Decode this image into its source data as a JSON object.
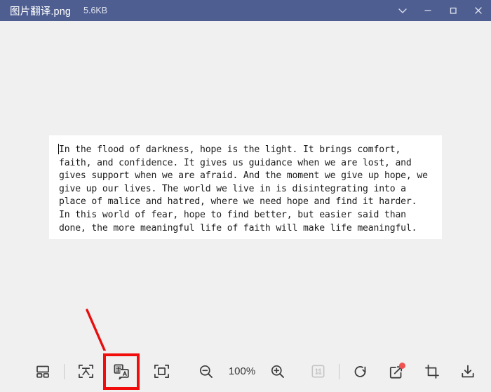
{
  "window": {
    "file_name": "图片翻译.png",
    "file_size": "5.6KB",
    "controls": [
      {
        "name": "chevron-down",
        "label": "∨"
      },
      {
        "name": "minimize",
        "label": "—"
      },
      {
        "name": "maximize",
        "label": "□"
      },
      {
        "name": "close",
        "label": "✕"
      }
    ]
  },
  "document": {
    "body_text": "In the flood of darkness, hope is the light. It brings comfort,\nfaith, and confidence. It gives us guidance when we are lost, and\ngives support when we are afraid. And the moment we give up hope, we\ngive up our lives. The world we live in is disintegrating into a\nplace of malice and hatred, where we need hope and find it harder.\nIn this world of fear, hope to find better, but easier said than\ndone, the more meaningful life of faith will make life meaningful."
  },
  "toolbar": {
    "zoom_level": "100%",
    "buttons": [
      {
        "name": "thumbnail-view",
        "label": "Thumbnail view"
      },
      {
        "name": "ocr-recognize",
        "label": "Text recognition"
      },
      {
        "name": "translate",
        "label": "Translate image"
      },
      {
        "name": "fit-to-screen",
        "label": "Fit to screen"
      },
      {
        "name": "zoom-out",
        "label": "Zoom out"
      },
      {
        "name": "zoom-in",
        "label": "Zoom in"
      },
      {
        "name": "actual-size",
        "label": "1:1 actual size"
      },
      {
        "name": "rotate-right",
        "label": "Rotate right"
      },
      {
        "name": "edit-annotate",
        "label": "Edit"
      },
      {
        "name": "crop",
        "label": "Crop"
      },
      {
        "name": "download",
        "label": "Save"
      }
    ]
  },
  "annotation": {
    "arrow_color": "#e80e0e",
    "highlight_color": "#f20d0d",
    "target": "translate"
  },
  "colors": {
    "titlebar": "#4e5e91",
    "canvas": "#f0f0f0",
    "card": "#ffffff",
    "icon": "#3c3c3c",
    "badge": "#ef5350"
  }
}
